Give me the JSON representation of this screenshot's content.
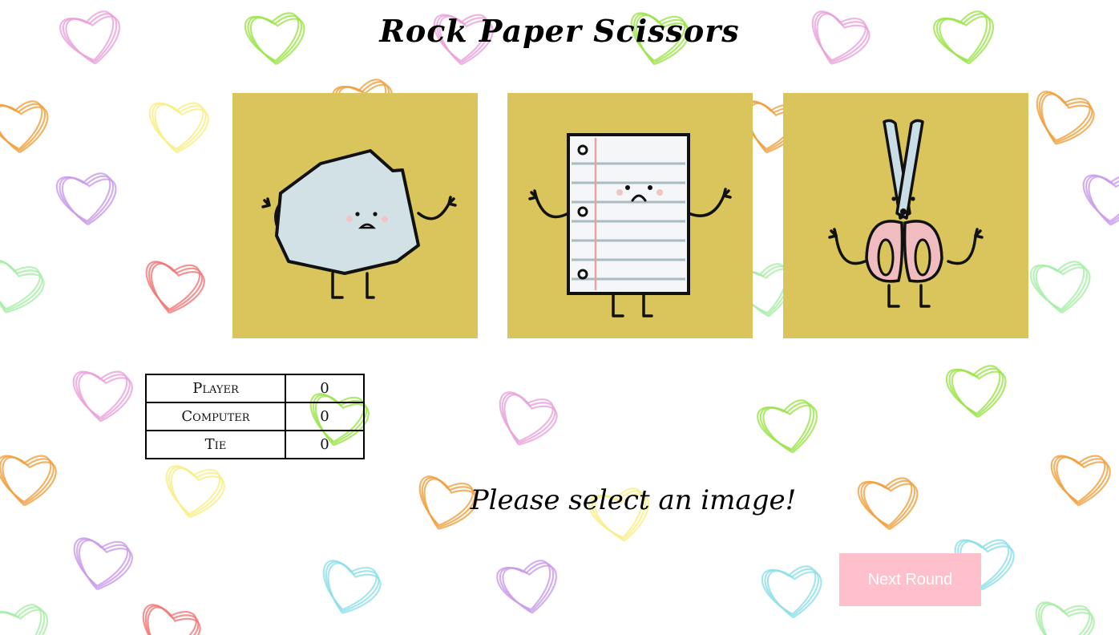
{
  "page": {
    "title": "Rock Paper Scissors",
    "background_pattern": "scribbled-hearts",
    "choice_background": "#d9c55b"
  },
  "choices": [
    {
      "name": "rock",
      "icon": "rock-character-icon"
    },
    {
      "name": "paper",
      "icon": "paper-character-icon"
    },
    {
      "name": "scissors",
      "icon": "scissors-character-icon"
    }
  ],
  "scoreboard": {
    "rows": [
      {
        "label": "Player",
        "value": "0"
      },
      {
        "label": "Computer",
        "value": "0"
      },
      {
        "label": "Tie",
        "value": "0"
      }
    ]
  },
  "message": "Please select an image!",
  "next_button": {
    "label": "Next Round",
    "color": "#ffc0cb"
  }
}
